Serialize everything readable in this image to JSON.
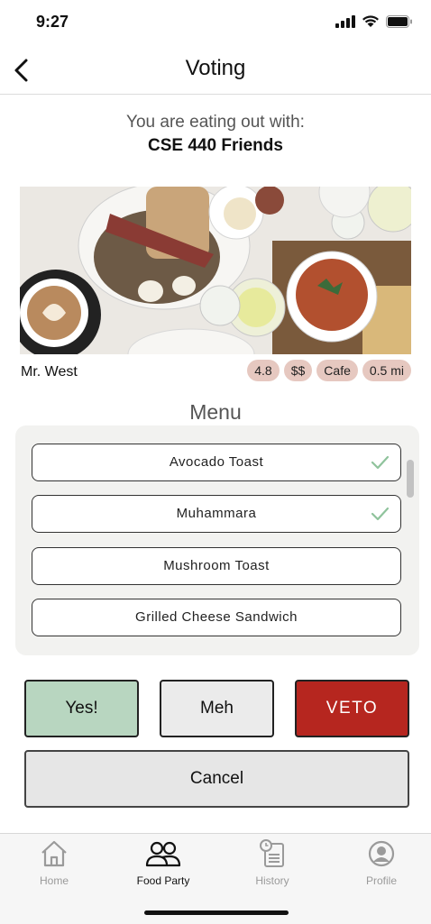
{
  "status_bar": {
    "time": "9:27"
  },
  "nav": {
    "title": "Voting"
  },
  "intro": {
    "eating_with_label": "You are eating out with:",
    "group_name": "CSE 440 Friends"
  },
  "restaurant": {
    "name": "Mr. West",
    "tags": [
      "4.8",
      "$$",
      "Cafe",
      "0.5 mi"
    ]
  },
  "menu": {
    "title": "Menu",
    "items": [
      {
        "label": "Avocado Toast",
        "checked": true
      },
      {
        "label": "Muhammara",
        "checked": true
      },
      {
        "label": "Mushroom Toast",
        "checked": false
      },
      {
        "label": "Grilled Cheese Sandwich",
        "checked": false
      }
    ]
  },
  "votes": {
    "yes_label": "Yes!",
    "meh_label": "Meh",
    "veto_label": "VETO",
    "cancel_label": "Cancel"
  },
  "colors": {
    "yes": "#b8d6c0",
    "veto": "#b6261f",
    "tag": "#e6c8c0",
    "check": "#8fc39c"
  },
  "tabs": [
    {
      "label": "Home",
      "icon": "home-icon",
      "active": false
    },
    {
      "label": "Food Party",
      "icon": "group-icon",
      "active": true
    },
    {
      "label": "History",
      "icon": "history-icon",
      "active": false
    },
    {
      "label": "Profile",
      "icon": "profile-icon",
      "active": false
    }
  ]
}
